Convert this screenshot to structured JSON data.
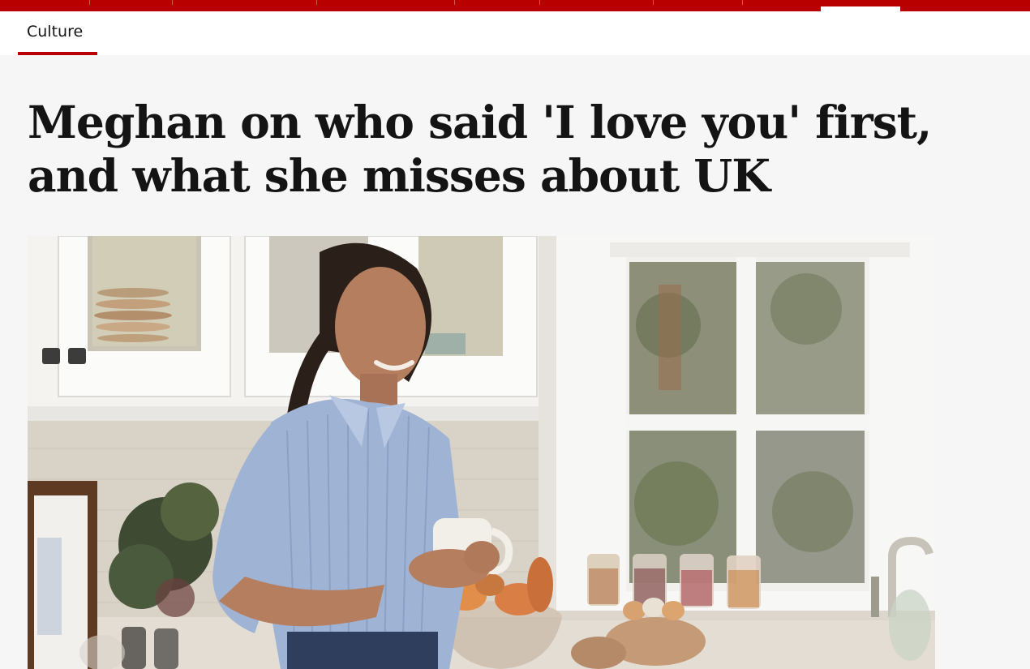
{
  "nav": {
    "section_label": "Culture"
  },
  "article": {
    "headline": "Meghan on who said 'I love you' first, and what she misses about UK"
  },
  "colors": {
    "brand_red": "#b80000",
    "background": "#f6f6f6",
    "text": "#141414"
  }
}
